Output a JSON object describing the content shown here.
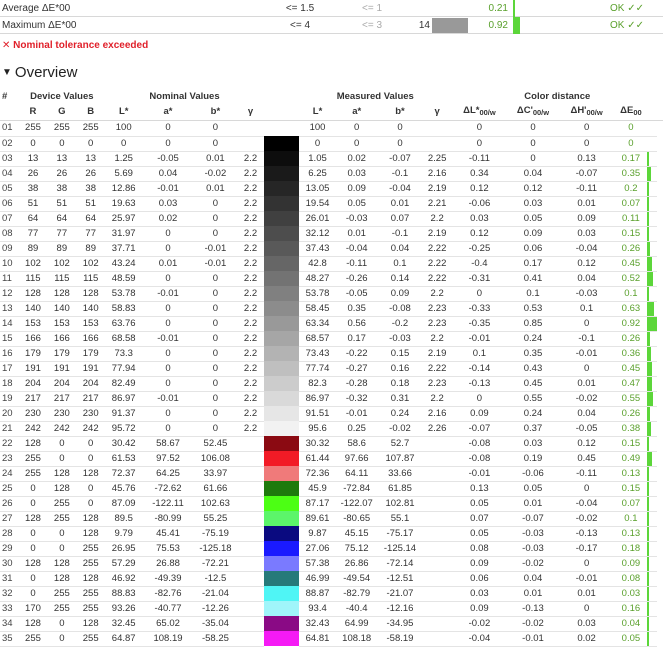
{
  "summary": [
    {
      "label": "Average ΔE*00",
      "nominal": "<= 1.5",
      "target": "<= 1",
      "worst_index": "",
      "worst_color": "",
      "value": "0.21",
      "status": "OK ✓✓"
    },
    {
      "label": "Maximum ΔE*00",
      "nominal": "<= 4",
      "target": "<= 3",
      "worst_index": "14",
      "worst_color": "#999999",
      "value": "0.92",
      "status": "OK ✓✓"
    }
  ],
  "warning": "✕ Nominal tolerance exceeded",
  "section": {
    "title": "Overview",
    "toggle_icon": "triangle-down"
  },
  "table": {
    "group_headers": {
      "index": "#",
      "device": "Device Values",
      "nominal": "Nominal Values",
      "measured": "Measured Values",
      "distance": "Color distance"
    },
    "columns": {
      "R": "R",
      "G": "G",
      "B": "B",
      "nom_L": "L*",
      "nom_a": "a*",
      "nom_b": "b*",
      "nom_gamma": "γ",
      "meas_L": "L*",
      "meas_a": "a*",
      "meas_b": "b*",
      "meas_gamma": "γ",
      "dL": "ΔL*",
      "dC": "ΔC'",
      "dH": "ΔH'",
      "sub_w": "00/w",
      "dE": "ΔE",
      "sub_00": "00"
    },
    "colors": {
      "accent_green": "#5cd63a",
      "ok_text": "#5aa02c",
      "error_red": "#e0202a"
    },
    "rows": [
      {
        "id": "01",
        "R": "255",
        "G": "255",
        "B": "255",
        "nL": "100",
        "na": "0",
        "nb": "0",
        "ng": "",
        "swatch": "#ffffff",
        "mL": "100",
        "ma": "0",
        "mb": "0",
        "mg": "",
        "dL": "0",
        "dC": "0",
        "dH": "0",
        "dE": "0",
        "de_value": 0
      },
      {
        "id": "02",
        "R": "0",
        "G": "0",
        "B": "0",
        "nL": "0",
        "na": "0",
        "nb": "0",
        "ng": "",
        "swatch": "#000000",
        "mL": "0",
        "ma": "0",
        "mb": "0",
        "mg": "",
        "dL": "0",
        "dC": "0",
        "dH": "0",
        "dE": "0",
        "de_value": 0
      },
      {
        "id": "03",
        "R": "13",
        "G": "13",
        "B": "13",
        "nL": "1.25",
        "na": "-0.05",
        "nb": "0.01",
        "ng": "2.2",
        "swatch": "#0d0d0d",
        "mL": "1.05",
        "ma": "0.02",
        "mb": "-0.07",
        "mg": "2.25",
        "dL": "-0.11",
        "dC": "0",
        "dH": "0.13",
        "dE": "0.17",
        "de_value": 0.17
      },
      {
        "id": "04",
        "R": "26",
        "G": "26",
        "B": "26",
        "nL": "5.69",
        "na": "0.04",
        "nb": "-0.02",
        "ng": "2.2",
        "swatch": "#1a1a1a",
        "mL": "6.25",
        "ma": "0.03",
        "mb": "-0.1",
        "mg": "2.16",
        "dL": "0.34",
        "dC": "0.04",
        "dH": "-0.07",
        "dE": "0.35",
        "de_value": 0.35
      },
      {
        "id": "05",
        "R": "38",
        "G": "38",
        "B": "38",
        "nL": "12.86",
        "na": "-0.01",
        "nb": "0.01",
        "ng": "2.2",
        "swatch": "#262626",
        "mL": "13.05",
        "ma": "0.09",
        "mb": "-0.04",
        "mg": "2.19",
        "dL": "0.12",
        "dC": "0.12",
        "dH": "-0.11",
        "dE": "0.2",
        "de_value": 0.2
      },
      {
        "id": "06",
        "R": "51",
        "G": "51",
        "B": "51",
        "nL": "19.63",
        "na": "0.03",
        "nb": "0",
        "ng": "2.2",
        "swatch": "#333333",
        "mL": "19.54",
        "ma": "0.05",
        "mb": "0.01",
        "mg": "2.21",
        "dL": "-0.06",
        "dC": "0.03",
        "dH": "0.01",
        "dE": "0.07",
        "de_value": 0.07
      },
      {
        "id": "07",
        "R": "64",
        "G": "64",
        "B": "64",
        "nL": "25.97",
        "na": "0.02",
        "nb": "0",
        "ng": "2.2",
        "swatch": "#404040",
        "mL": "26.01",
        "ma": "-0.03",
        "mb": "0.07",
        "mg": "2.2",
        "dL": "0.03",
        "dC": "0.05",
        "dH": "0.09",
        "dE": "0.11",
        "de_value": 0.11
      },
      {
        "id": "08",
        "R": "77",
        "G": "77",
        "B": "77",
        "nL": "31.97",
        "na": "0",
        "nb": "0",
        "ng": "2.2",
        "swatch": "#4d4d4d",
        "mL": "32.12",
        "ma": "0.01",
        "mb": "-0.1",
        "mg": "2.19",
        "dL": "0.12",
        "dC": "0.09",
        "dH": "0.03",
        "dE": "0.15",
        "de_value": 0.15
      },
      {
        "id": "09",
        "R": "89",
        "G": "89",
        "B": "89",
        "nL": "37.71",
        "na": "0",
        "nb": "-0.01",
        "ng": "2.2",
        "swatch": "#595959",
        "mL": "37.43",
        "ma": "-0.04",
        "mb": "0.04",
        "mg": "2.22",
        "dL": "-0.25",
        "dC": "0.06",
        "dH": "-0.04",
        "dE": "0.26",
        "de_value": 0.26
      },
      {
        "id": "10",
        "R": "102",
        "G": "102",
        "B": "102",
        "nL": "43.24",
        "na": "0.01",
        "nb": "-0.01",
        "ng": "2.2",
        "swatch": "#666666",
        "mL": "42.8",
        "ma": "-0.11",
        "mb": "0.1",
        "mg": "2.22",
        "dL": "-0.4",
        "dC": "0.17",
        "dH": "0.12",
        "dE": "0.45",
        "de_value": 0.45
      },
      {
        "id": "11",
        "R": "115",
        "G": "115",
        "B": "115",
        "nL": "48.59",
        "na": "0",
        "nb": "0",
        "ng": "2.2",
        "swatch": "#737373",
        "mL": "48.27",
        "ma": "-0.26",
        "mb": "0.14",
        "mg": "2.22",
        "dL": "-0.31",
        "dC": "0.41",
        "dH": "0.04",
        "dE": "0.52",
        "de_value": 0.52
      },
      {
        "id": "12",
        "R": "128",
        "G": "128",
        "B": "128",
        "nL": "53.78",
        "na": "-0.01",
        "nb": "0",
        "ng": "2.2",
        "swatch": "#808080",
        "mL": "53.78",
        "ma": "-0.05",
        "mb": "0.09",
        "mg": "2.2",
        "dL": "0",
        "dC": "0.1",
        "dH": "-0.03",
        "dE": "0.1",
        "de_value": 0.1
      },
      {
        "id": "13",
        "R": "140",
        "G": "140",
        "B": "140",
        "nL": "58.83",
        "na": "0",
        "nb": "0",
        "ng": "2.2",
        "swatch": "#8c8c8c",
        "mL": "58.45",
        "ma": "0.35",
        "mb": "-0.08",
        "mg": "2.23",
        "dL": "-0.33",
        "dC": "0.53",
        "dH": "0.1",
        "dE": "0.63",
        "de_value": 0.63
      },
      {
        "id": "14",
        "R": "153",
        "G": "153",
        "B": "153",
        "nL": "63.76",
        "na": "0",
        "nb": "0",
        "ng": "2.2",
        "swatch": "#999999",
        "mL": "63.34",
        "ma": "0.56",
        "mb": "-0.2",
        "mg": "2.23",
        "dL": "-0.35",
        "dC": "0.85",
        "dH": "0",
        "dE": "0.92",
        "de_value": 0.92
      },
      {
        "id": "15",
        "R": "166",
        "G": "166",
        "B": "166",
        "nL": "68.58",
        "na": "-0.01",
        "nb": "0",
        "ng": "2.2",
        "swatch": "#a6a6a6",
        "mL": "68.57",
        "ma": "0.17",
        "mb": "-0.03",
        "mg": "2.2",
        "dL": "-0.01",
        "dC": "0.24",
        "dH": "-0.1",
        "dE": "0.26",
        "de_value": 0.26
      },
      {
        "id": "16",
        "R": "179",
        "G": "179",
        "B": "179",
        "nL": "73.3",
        "na": "0",
        "nb": "0",
        "ng": "2.2",
        "swatch": "#b3b3b3",
        "mL": "73.43",
        "ma": "-0.22",
        "mb": "0.15",
        "mg": "2.19",
        "dL": "0.1",
        "dC": "0.35",
        "dH": "-0.01",
        "dE": "0.36",
        "de_value": 0.36
      },
      {
        "id": "17",
        "R": "191",
        "G": "191",
        "B": "191",
        "nL": "77.94",
        "na": "0",
        "nb": "0",
        "ng": "2.2",
        "swatch": "#bfbfbf",
        "mL": "77.74",
        "ma": "-0.27",
        "mb": "0.16",
        "mg": "2.22",
        "dL": "-0.14",
        "dC": "0.43",
        "dH": "0",
        "dE": "0.45",
        "de_value": 0.45
      },
      {
        "id": "18",
        "R": "204",
        "G": "204",
        "B": "204",
        "nL": "82.49",
        "na": "0",
        "nb": "0",
        "ng": "2.2",
        "swatch": "#cccccc",
        "mL": "82.3",
        "ma": "-0.28",
        "mb": "0.18",
        "mg": "2.23",
        "dL": "-0.13",
        "dC": "0.45",
        "dH": "0.01",
        "dE": "0.47",
        "de_value": 0.47
      },
      {
        "id": "19",
        "R": "217",
        "G": "217",
        "B": "217",
        "nL": "86.97",
        "na": "-0.01",
        "nb": "0",
        "ng": "2.2",
        "swatch": "#d9d9d9",
        "mL": "86.97",
        "ma": "-0.32",
        "mb": "0.31",
        "mg": "2.2",
        "dL": "0",
        "dC": "0.55",
        "dH": "-0.02",
        "dE": "0.55",
        "de_value": 0.55
      },
      {
        "id": "20",
        "R": "230",
        "G": "230",
        "B": "230",
        "nL": "91.37",
        "na": "0",
        "nb": "0",
        "ng": "2.2",
        "swatch": "#e6e6e6",
        "mL": "91.51",
        "ma": "-0.01",
        "mb": "0.24",
        "mg": "2.16",
        "dL": "0.09",
        "dC": "0.24",
        "dH": "0.04",
        "dE": "0.26",
        "de_value": 0.26
      },
      {
        "id": "21",
        "R": "242",
        "G": "242",
        "B": "242",
        "nL": "95.72",
        "na": "0",
        "nb": "0",
        "ng": "2.2",
        "swatch": "#f2f2f2",
        "mL": "95.6",
        "ma": "0.25",
        "mb": "-0.02",
        "mg": "2.26",
        "dL": "-0.07",
        "dC": "0.37",
        "dH": "-0.05",
        "dE": "0.38",
        "de_value": 0.38
      },
      {
        "id": "22",
        "R": "128",
        "G": "0",
        "B": "0",
        "nL": "30.42",
        "na": "58.67",
        "nb": "52.45",
        "ng": "",
        "swatch": "#8b0a12",
        "mL": "30.32",
        "ma": "58.6",
        "mb": "52.7",
        "mg": "",
        "dL": "-0.08",
        "dC": "0.03",
        "dH": "0.12",
        "dE": "0.15",
        "de_value": 0.15
      },
      {
        "id": "23",
        "R": "255",
        "G": "0",
        "B": "0",
        "nL": "61.53",
        "na": "97.52",
        "nb": "106.08",
        "ng": "",
        "swatch": "#f21b26",
        "mL": "61.44",
        "ma": "97.66",
        "mb": "107.87",
        "mg": "",
        "dL": "-0.08",
        "dC": "0.19",
        "dH": "0.45",
        "dE": "0.49",
        "de_value": 0.49
      },
      {
        "id": "24",
        "R": "255",
        "G": "128",
        "B": "128",
        "nL": "72.37",
        "na": "64.25",
        "nb": "33.97",
        "ng": "",
        "swatch": "#f07a7a",
        "mL": "72.36",
        "ma": "64.11",
        "mb": "33.66",
        "mg": "",
        "dL": "-0.01",
        "dC": "-0.06",
        "dH": "-0.11",
        "dE": "0.13",
        "de_value": 0.13
      },
      {
        "id": "25",
        "R": "0",
        "G": "128",
        "B": "0",
        "nL": "45.76",
        "na": "-72.62",
        "nb": "61.66",
        "ng": "",
        "swatch": "#1e7a0c",
        "mL": "45.9",
        "ma": "-72.84",
        "mb": "61.85",
        "mg": "",
        "dL": "0.13",
        "dC": "0.05",
        "dH": "0",
        "dE": "0.15",
        "de_value": 0.15
      },
      {
        "id": "26",
        "R": "0",
        "G": "255",
        "B": "0",
        "nL": "87.09",
        "na": "-122.11",
        "nb": "102.63",
        "ng": "",
        "swatch": "#4cff14",
        "mL": "87.17",
        "ma": "-122.07",
        "mb": "102.81",
        "mg": "",
        "dL": "0.05",
        "dC": "0.01",
        "dH": "-0.04",
        "dE": "0.07",
        "de_value": 0.07
      },
      {
        "id": "27",
        "R": "128",
        "G": "255",
        "B": "128",
        "nL": "89.5",
        "na": "-80.99",
        "nb": "55.25",
        "ng": "",
        "swatch": "#5cf56a",
        "mL": "89.61",
        "ma": "-80.65",
        "mb": "55.1",
        "mg": "",
        "dL": "0.07",
        "dC": "-0.07",
        "dH": "-0.02",
        "dE": "0.1",
        "de_value": 0.1
      },
      {
        "id": "28",
        "R": "0",
        "G": "0",
        "B": "128",
        "nL": "9.79",
        "na": "45.41",
        "nb": "-75.19",
        "ng": "",
        "swatch": "#0a0a80",
        "mL": "9.87",
        "ma": "45.15",
        "mb": "-75.17",
        "mg": "",
        "dL": "0.05",
        "dC": "-0.03",
        "dH": "-0.13",
        "dE": "0.13",
        "de_value": 0.13
      },
      {
        "id": "29",
        "R": "0",
        "G": "0",
        "B": "255",
        "nL": "26.95",
        "na": "75.53",
        "nb": "-125.18",
        "ng": "",
        "swatch": "#1a1aff",
        "mL": "27.06",
        "ma": "75.12",
        "mb": "-125.14",
        "mg": "",
        "dL": "0.08",
        "dC": "-0.03",
        "dH": "-0.17",
        "dE": "0.18",
        "de_value": 0.18
      },
      {
        "id": "30",
        "R": "128",
        "G": "128",
        "B": "255",
        "nL": "57.29",
        "na": "26.88",
        "nb": "-72.21",
        "ng": "",
        "swatch": "#7a7aff",
        "mL": "57.38",
        "ma": "26.86",
        "mb": "-72.14",
        "mg": "",
        "dL": "0.09",
        "dC": "-0.02",
        "dH": "0",
        "dE": "0.09",
        "de_value": 0.09
      },
      {
        "id": "31",
        "R": "0",
        "G": "128",
        "B": "128",
        "nL": "46.92",
        "na": "-49.39",
        "nb": "-12.5",
        "ng": "",
        "swatch": "#267a7a",
        "mL": "46.99",
        "ma": "-49.54",
        "mb": "-12.51",
        "mg": "",
        "dL": "0.06",
        "dC": "0.04",
        "dH": "-0.01",
        "dE": "0.08",
        "de_value": 0.08
      },
      {
        "id": "32",
        "R": "0",
        "G": "255",
        "B": "255",
        "nL": "88.83",
        "na": "-82.76",
        "nb": "-21.04",
        "ng": "",
        "swatch": "#4ff5f5",
        "mL": "88.87",
        "ma": "-82.79",
        "mb": "-21.07",
        "mg": "",
        "dL": "0.03",
        "dC": "0.01",
        "dH": "0.01",
        "dE": "0.03",
        "de_value": 0.03
      },
      {
        "id": "33",
        "R": "170",
        "G": "255",
        "B": "255",
        "nL": "93.26",
        "na": "-40.77",
        "nb": "-12.26",
        "ng": "",
        "swatch": "#a0f5fa",
        "mL": "93.4",
        "ma": "-40.4",
        "mb": "-12.16",
        "mg": "",
        "dL": "0.09",
        "dC": "-0.13",
        "dH": "0",
        "dE": "0.16",
        "de_value": 0.16
      },
      {
        "id": "34",
        "R": "128",
        "G": "0",
        "B": "128",
        "nL": "32.45",
        "na": "65.02",
        "nb": "-35.04",
        "ng": "",
        "swatch": "#8a0a85",
        "mL": "32.43",
        "ma": "64.99",
        "mb": "-34.95",
        "mg": "",
        "dL": "-0.02",
        "dC": "-0.02",
        "dH": "0.03",
        "dE": "0.04",
        "de_value": 0.04
      },
      {
        "id": "35",
        "R": "255",
        "G": "0",
        "B": "255",
        "nL": "64.87",
        "na": "108.19",
        "nb": "-58.25",
        "ng": "",
        "swatch": "#f51af5",
        "mL": "64.81",
        "ma": "108.18",
        "mb": "-58.19",
        "mg": "",
        "dL": "-0.04",
        "dC": "-0.01",
        "dH": "0.02",
        "dE": "0.05",
        "de_value": 0.05
      }
    ]
  }
}
